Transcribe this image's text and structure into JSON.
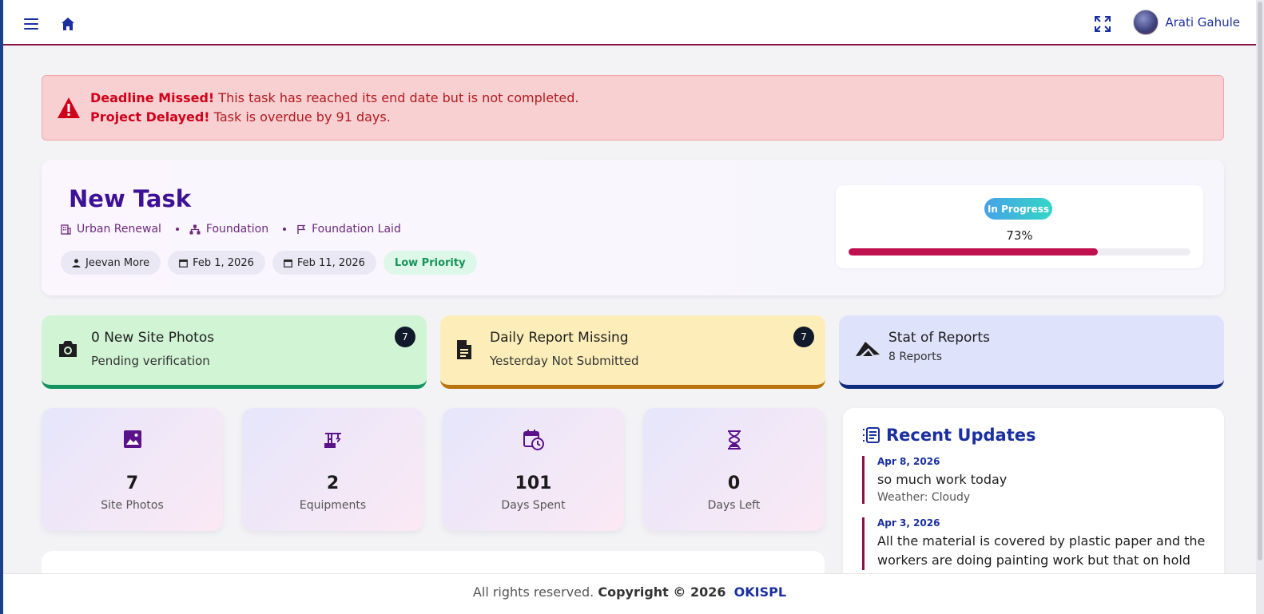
{
  "header": {
    "user_name": "Arati Gahule",
    "icons": [
      "menu-icon",
      "home-icon",
      "fullscreen-icon"
    ]
  },
  "alert": {
    "line1_bold": "Deadline Missed!",
    "line1_text": " This task has reached its end date but is not completed.",
    "line2_bold": "Project Delayed!",
    "line2_text": " Task is overdue by 91 days."
  },
  "task": {
    "title": "New Task",
    "project": "Urban Renewal",
    "phase": "Foundation",
    "milestone": "Foundation Laid",
    "assignee": "Jeevan More",
    "start_date": "Feb 1, 2026",
    "end_date": "Feb 11, 2026",
    "priority": "Low Priority",
    "status": "In Progress",
    "progress_label": "73%",
    "progress": 73
  },
  "stats": [
    {
      "title": "0 New Site Photos",
      "subtitle": "Pending verification",
      "count": "7"
    },
    {
      "title": "Daily Report Missing",
      "subtitle": "Yesterday Not Submitted",
      "count": "7"
    },
    {
      "title": "Stat of Reports",
      "subtitle": "8 Reports"
    }
  ],
  "metrics": [
    {
      "value": "7",
      "label": "Site Photos"
    },
    {
      "value": "2",
      "label": "Equipments"
    },
    {
      "value": "101",
      "label": "Days Spent"
    },
    {
      "value": "0",
      "label": "Days Left"
    }
  ],
  "updates": {
    "title": "Recent Updates",
    "items": [
      {
        "date": "Apr 8, 2026",
        "text": "so much work today",
        "weather": "Weather: Cloudy"
      },
      {
        "date": "Apr 3, 2026",
        "text": "All the material is covered by plastic paper and the workers are doing painting work but that on hold"
      }
    ]
  },
  "footer": {
    "text": "All rights reserved. ",
    "copyright": "Copyright © 2026",
    "brand": "OKISPL"
  },
  "colors": {
    "accent": "#3d1296",
    "progress": "#c0114f",
    "nav_border": "#8a1346",
    "alert_bg": "#f8d0d1"
  }
}
